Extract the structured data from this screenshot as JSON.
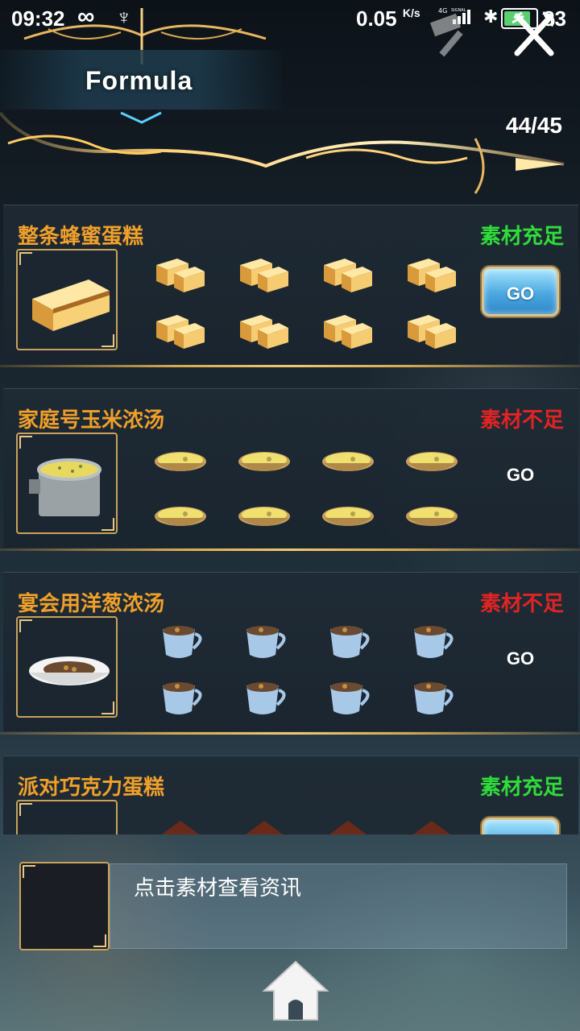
{
  "status_bar": {
    "time": "09:32",
    "infinity_glyph": "∞",
    "app_glyph": "♆",
    "net_speed": "0.05",
    "net_unit": "K/s",
    "signal_label": "SIGNAL",
    "network_type": "4G",
    "battery_percent": "83",
    "battery_level": 0.83
  },
  "header": {
    "title": "Formula",
    "count": "44/45"
  },
  "recipes": [
    {
      "name": "整条蜂蜜蛋糕",
      "status": "素材充足",
      "status_type": "ok",
      "go_label": "GO",
      "go_active": true,
      "material_icon": "honey-cake-icon"
    },
    {
      "name": "家庭号玉米浓汤",
      "status": "素材不足",
      "status_type": "no",
      "go_label": "GO",
      "go_active": false,
      "material_icon": "corn-soup-icon"
    },
    {
      "name": "宴会用洋葱浓汤",
      "status": "素材不足",
      "status_type": "no",
      "go_label": "GO",
      "go_active": false,
      "material_icon": "onion-soup-cup-icon"
    },
    {
      "name": "派对巧克力蛋糕",
      "status": "素材充足",
      "status_type": "ok",
      "go_label": "GO",
      "go_active": true,
      "material_icon": "chocolate-cake-icon"
    }
  ],
  "info": {
    "hint": "点击素材查看资讯"
  },
  "colors": {
    "title_orange": "#f0a02a",
    "status_ok": "#2fdc3a",
    "status_no": "#e02424",
    "gold": "#d8a850"
  }
}
